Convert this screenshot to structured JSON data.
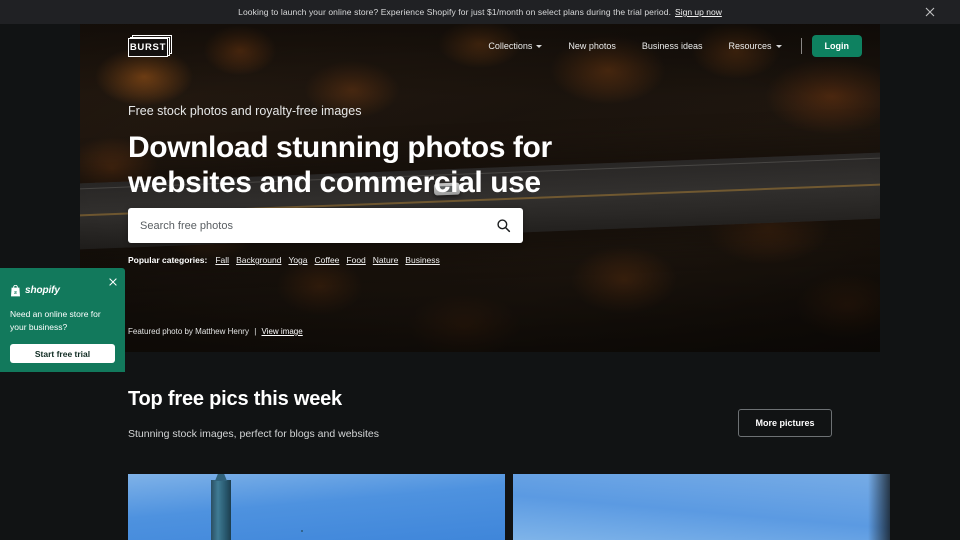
{
  "promo": {
    "text": "Looking to launch your online store? Experience Shopify for just $1/month on select plans during the trial period.",
    "link": "Sign up now",
    "close_icon": "close-icon"
  },
  "header": {
    "logo_text": "BURST",
    "nav": [
      {
        "label": "Collections",
        "has_caret": true
      },
      {
        "label": "New photos",
        "has_caret": false
      },
      {
        "label": "Business ideas",
        "has_caret": false
      },
      {
        "label": "Resources",
        "has_caret": true
      }
    ],
    "login_label": "Login",
    "login_color": "#0e8160"
  },
  "hero": {
    "eyebrow": "Free stock photos and royalty-free images",
    "title": "Download stunning photos for websites and commercial use",
    "search": {
      "placeholder": "Search free photos",
      "value": "",
      "icon": "search-icon"
    },
    "categories_label": "Popular categories:",
    "categories": [
      "Fall",
      "Background",
      "Yoga",
      "Coffee",
      "Food",
      "Nature",
      "Business"
    ],
    "credit_prefix": "Featured photo by Matthew Henry",
    "credit_separator": "|",
    "credit_link": "View image"
  },
  "shopify_popup": {
    "brand": "shopify",
    "message": "Need an online store for your business?",
    "cta": "Start free trial",
    "background_color": "#12795c",
    "close_icon": "close-icon"
  },
  "section": {
    "title": "Top free pics this week",
    "subtitle": "Stunning stock images, perfect for blogs and websites",
    "more_button": "More pictures"
  },
  "cards": [
    {
      "alt": "skyscraper against blue sky"
    },
    {
      "alt": "clear blue sky"
    }
  ]
}
